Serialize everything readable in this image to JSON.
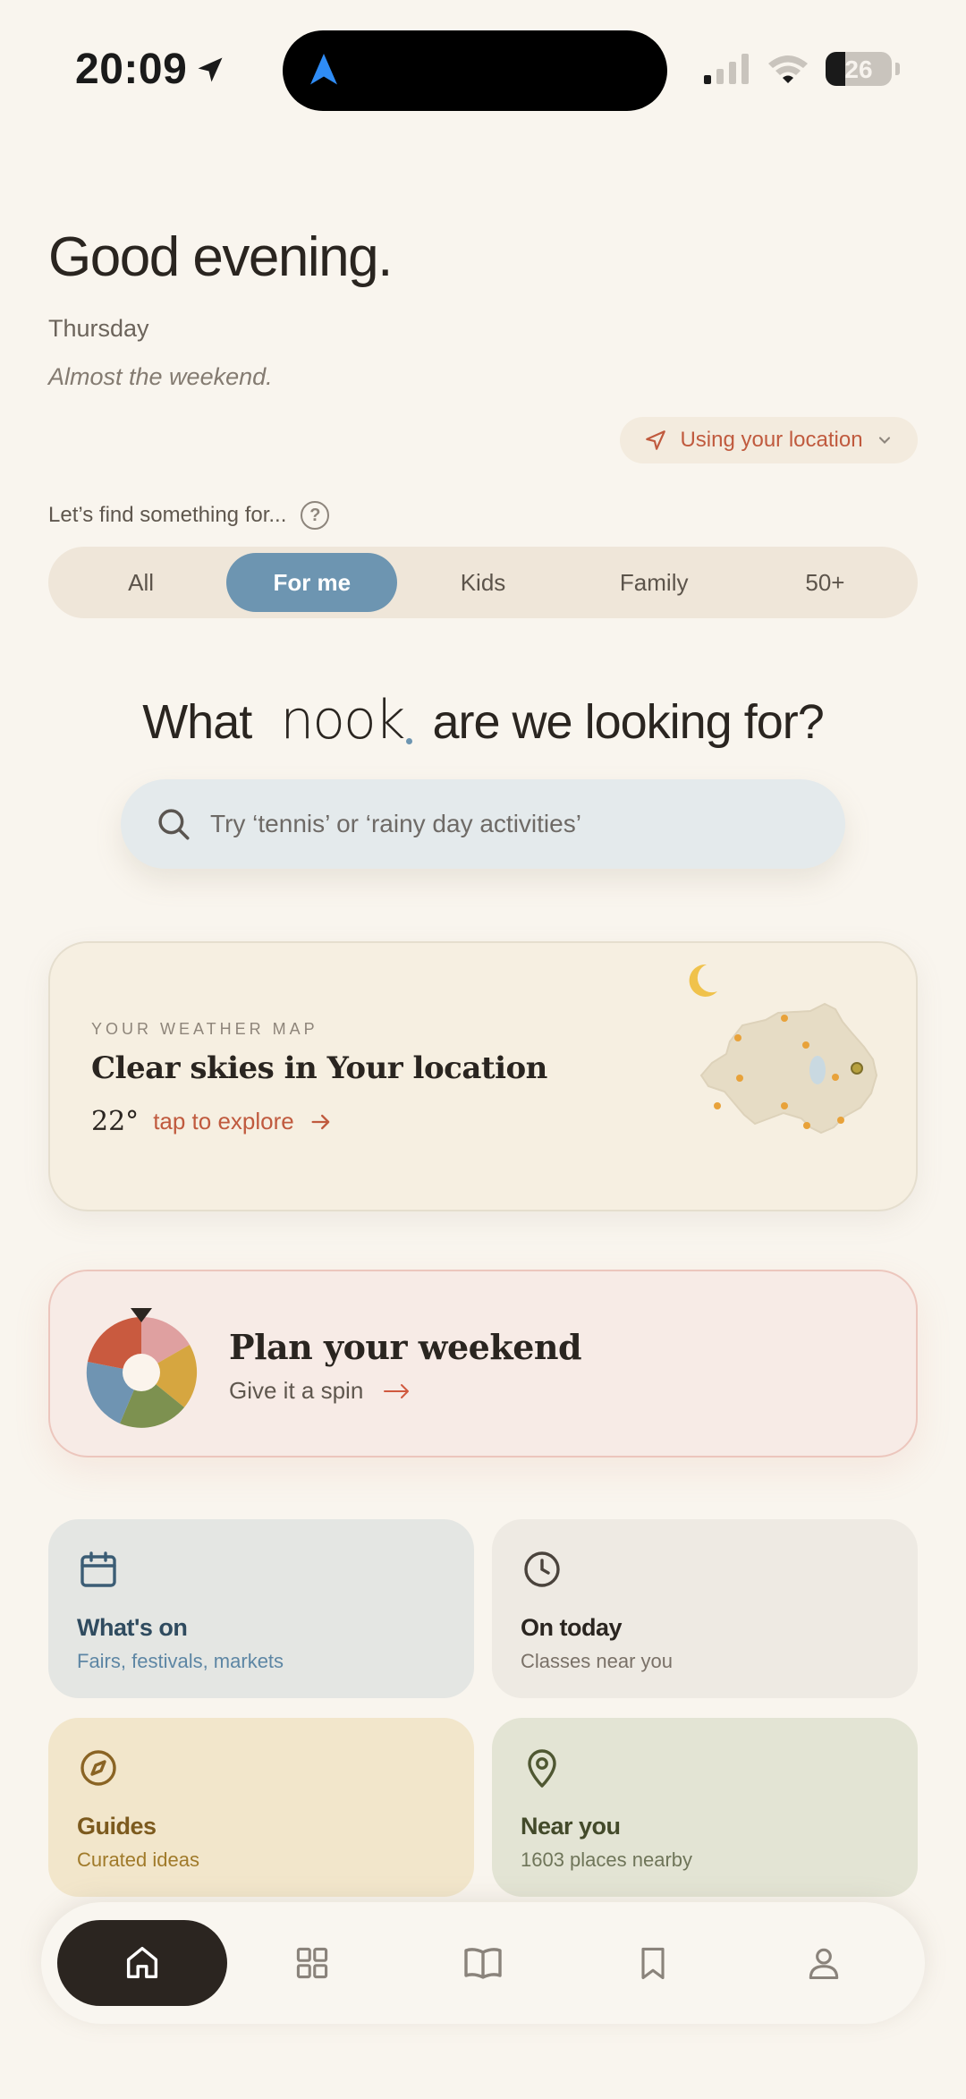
{
  "status_bar": {
    "time": "20:09",
    "battery": "26"
  },
  "greeting": {
    "title": "Good evening.",
    "day": "Thursday",
    "tagline": "Almost the weekend."
  },
  "location": {
    "label": "Using your location"
  },
  "audience": {
    "prompt": "Let’s find something for...",
    "options": [
      "All",
      "For me",
      "Kids",
      "Family",
      "50+"
    ],
    "selected": "For me"
  },
  "search": {
    "headline_before": "What",
    "brand": "nook",
    "headline_after": "are we looking for?",
    "placeholder": "Try ‘tennis’ or ‘rainy day activities’"
  },
  "weather_card": {
    "eyebrow": "YOUR WEATHER MAP",
    "title": "Clear skies in Your location",
    "temperature": "22°",
    "link": "tap to explore"
  },
  "plan_card": {
    "title": "Plan your weekend",
    "subtitle": "Give it a spin"
  },
  "tiles": [
    {
      "title": "What's on",
      "subtitle": "Fairs, festivals, markets",
      "icon": "calendar-icon"
    },
    {
      "title": "On today",
      "subtitle": "Classes near you",
      "icon": "clock-icon"
    },
    {
      "title": "Guides",
      "subtitle": "Curated ideas",
      "icon": "compass-icon"
    },
    {
      "title": "Near you",
      "subtitle": "1603 places nearby",
      "icon": "map-pin-icon"
    }
  ],
  "bottom_nav": {
    "items": [
      "home-icon",
      "grid-icon",
      "book-icon",
      "bookmark-icon",
      "profile-icon"
    ],
    "active": "home-icon"
  },
  "colors": {
    "background": "#f9f5ee",
    "accent_blue": "#6d95b1",
    "accent_red": "#c05a3e",
    "dark": "#2b2520"
  }
}
